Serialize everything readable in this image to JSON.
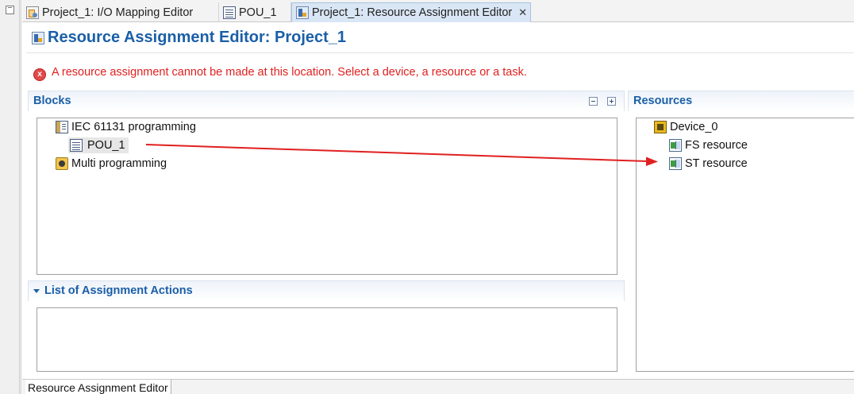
{
  "tabs": [
    {
      "label": "Project_1: I/O Mapping Editor",
      "icon": "io-mapping-icon",
      "active": false
    },
    {
      "label": "POU_1",
      "icon": "pou-document-icon",
      "active": false
    },
    {
      "label": "Project_1: Resource Assignment Editor",
      "icon": "resource-assignment-icon",
      "active": true,
      "close": "✕"
    }
  ],
  "editor": {
    "title": "Resource Assignment Editor: Project_1",
    "error_message": "A resource assignment cannot be made at this location. Select a device, a resource or a task.",
    "error_icon_glyph": "x"
  },
  "blocks": {
    "title": "Blocks",
    "items": [
      {
        "label": "IEC 61131 programming",
        "icon": "iec-programming-icon",
        "level": 0
      },
      {
        "label": "POU_1",
        "icon": "pou-document-icon",
        "level": 1,
        "selected": true
      },
      {
        "label": "Multi programming",
        "icon": "multi-programming-icon",
        "level": 0
      }
    ]
  },
  "resources": {
    "title": "Resources",
    "items": [
      {
        "label": "Device_0",
        "icon": "device-icon",
        "level": 0
      },
      {
        "label": "FS resource",
        "icon": "resource-icon",
        "level": 1
      },
      {
        "label": "ST resource",
        "icon": "resource-icon",
        "level": 1
      }
    ]
  },
  "assignment_actions": {
    "title": "List of Assignment Actions"
  },
  "bottom_tab": {
    "label": "Resource Assignment Editor"
  },
  "colors": {
    "accent": "#1a5fa8",
    "error": "#e02020",
    "drag_arrow": "#e02020"
  }
}
